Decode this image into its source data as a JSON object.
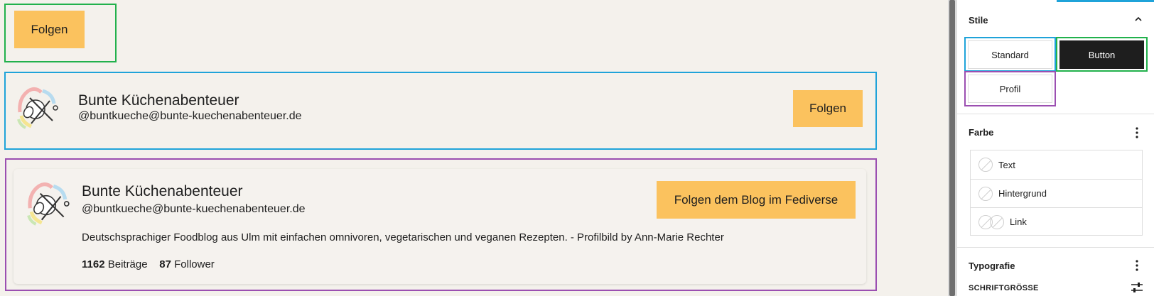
{
  "content": {
    "button_block": {
      "follow_label": "Folgen"
    },
    "standard_block": {
      "name": "Bunte Küchenabenteuer",
      "handle": "@buntkueche@bunte-kuechenabenteuer.de",
      "follow_label": "Folgen"
    },
    "profile_block": {
      "name": "Bunte Küchenabenteuer",
      "handle": "@buntkueche@bunte-kuechenabenteuer.de",
      "follow_label": "Folgen dem Blog im Fediverse",
      "description": "Deutschsprachiger Foodblog aus Ulm mit einfachen omnivoren, vegetarischen und veganen Rezepten. - Profilbild by Ann-Marie Rechter",
      "posts_count": "1162",
      "posts_label": "Beiträge",
      "followers_count": "87",
      "followers_label": "Follower"
    }
  },
  "sidebar": {
    "styles": {
      "title": "Stile",
      "options": [
        "Standard",
        "Button",
        "Profil"
      ],
      "active": "Button"
    },
    "color": {
      "title": "Farbe",
      "items": [
        "Text",
        "Hintergrund",
        "Link"
      ]
    },
    "typography": {
      "title": "Typografie",
      "font_size_label": "SCHRIFTGRÖSSE"
    }
  },
  "colors": {
    "follow_button": "#fbc25e",
    "highlight_green": "#22b14c",
    "highlight_blue": "#1fa3d9",
    "highlight_purple": "#9b4fb1",
    "canvas_bg": "#f4f1ec"
  }
}
